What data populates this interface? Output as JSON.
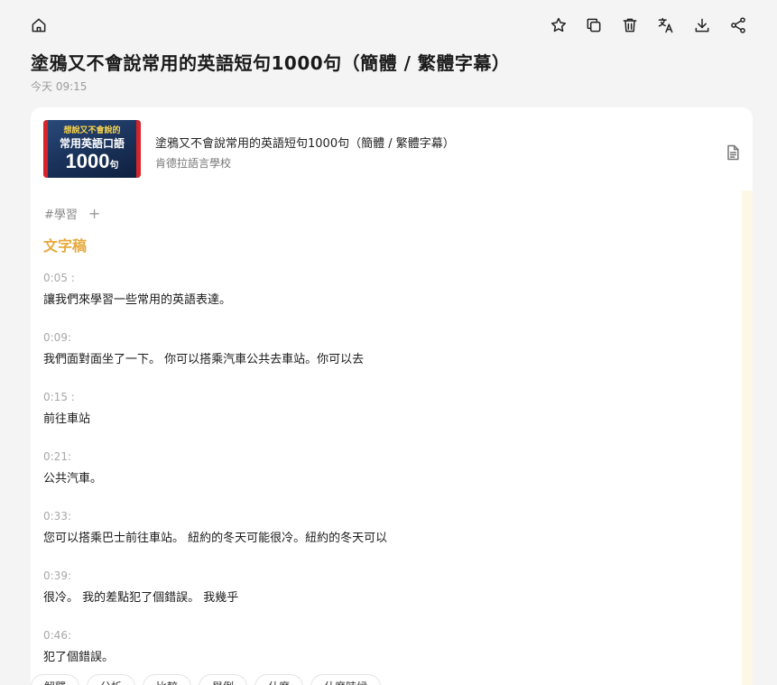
{
  "header": {
    "title": "塗鴉又不會說常用的英語短句1000句（簡體 / 繁體字幕）",
    "time": "今天 09:15",
    "icons": [
      "home-icon",
      "star-icon",
      "copy-icon",
      "trash-icon",
      "translate-icon",
      "download-icon",
      "share-icon"
    ]
  },
  "media": {
    "thumb_line1": "想說又不會說的",
    "thumb_line2": "常用英語口語",
    "thumb_number": "1000",
    "thumb_unit": "句",
    "title": "塗鴉又不會說常用的英語短句1000句（簡體 / 繁體字幕）",
    "source": "肯德拉語言學校"
  },
  "tags": {
    "items": [
      "#學習"
    ],
    "add_label": "+"
  },
  "transcript": {
    "heading": "文字稿",
    "segments": [
      {
        "time": "0:05 :",
        "text": "讓我們來學習一些常用的英語表達。"
      },
      {
        "time": "0:09:",
        "text": "我們面對面坐了一下。 你可以搭乘汽車公共去車站。你可以去"
      },
      {
        "time": "0:15 :",
        "text": "前往車站"
      },
      {
        "time": "0:21:",
        "text": "公共汽車。"
      },
      {
        "time": "0:33:",
        "text": "您可以搭乘巴士前往車站。 紐約的冬天可能很冷。紐約的冬天可以"
      },
      {
        "time": "0:39:",
        "text": "很冷。 我的差點犯了個錯誤。 我幾乎"
      },
      {
        "time": "0:46:",
        "text": "犯了個錯誤。"
      }
    ]
  },
  "chips": [
    "解釋",
    "分析",
    "比較",
    "舉例",
    "什麼",
    "什麼時候"
  ],
  "colors": {
    "accent": "#e6a93e",
    "background": "#f4f4f5",
    "card": "#ffffff"
  }
}
